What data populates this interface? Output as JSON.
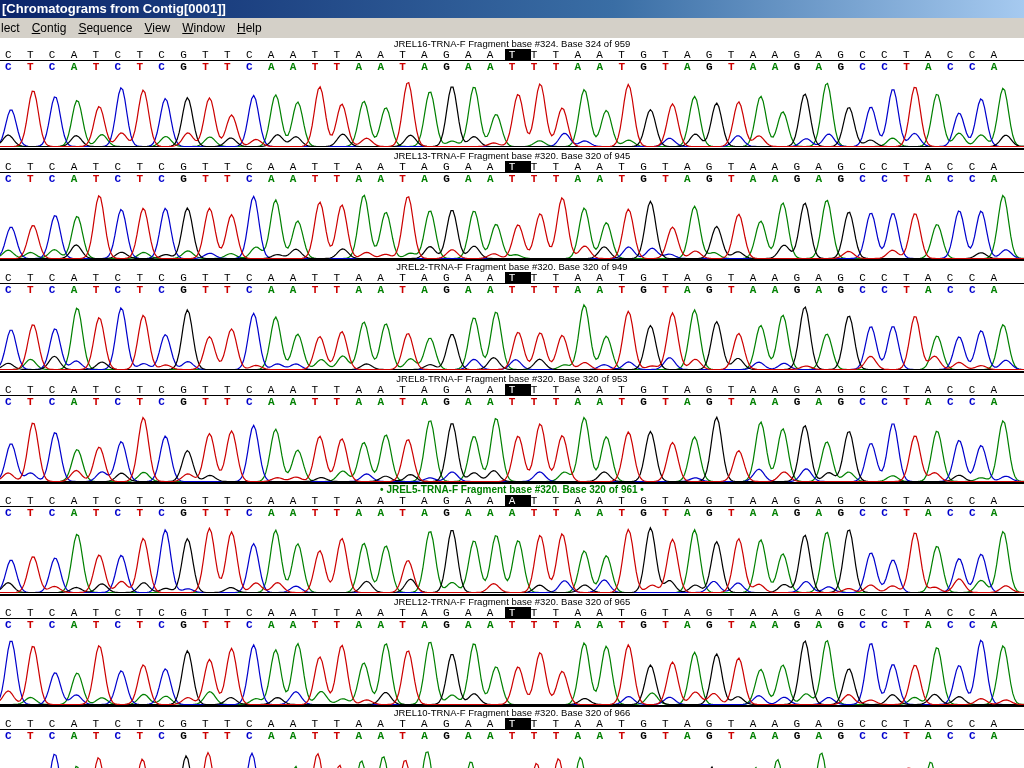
{
  "window": {
    "title": "[Chromatograms from Contig[0001]]"
  },
  "menu": [
    {
      "label": "lect",
      "underline_first": false
    },
    {
      "label": "Contig",
      "underline_first": true
    },
    {
      "label": "Sequence",
      "underline_first": true
    },
    {
      "label": "View",
      "underline_first": true
    },
    {
      "label": "Window",
      "underline_first": true
    },
    {
      "label": "Help",
      "underline_first": true
    }
  ],
  "base_colors": {
    "A": {
      "color": "#008000"
    },
    "C": {
      "color": "#0000cc"
    },
    "G": {
      "color": "#000000"
    },
    "T": {
      "color": "#cc0000"
    }
  },
  "panels": [
    {
      "header": "JREL16-TRNA-F  Fragment base #324. Base 324 of 959",
      "selected": false,
      "consensus": {
        "before": "CTCATCTCGTTCAATTAATAGAA",
        "cursor": "T",
        "after": "TTAATGTAGTAAGAGCCTACCA"
      },
      "called": "CTCATCTCGTTCAATTAATAGAATTTAATGTAGTAAGAGCCTACCA"
    },
    {
      "header": "JREL13-TRNA-F  Fragment base #320. Base 320 of 945",
      "selected": false,
      "consensus": {
        "before": "CTCATCTCGTTCAATTAATAGAA",
        "cursor": "T",
        "after": "TTAATGTAGTAAGAGCCTACCA"
      },
      "called": "CTCATCTCGTTCAATTAATAGAATTTAATGTAGTAAGAGCCTACCA"
    },
    {
      "header": "JREL2-TRNA-F  Fragment base #320. Base 320 of 949",
      "selected": false,
      "consensus": {
        "before": "CTCATCTCGTTCAATTAATAGAA",
        "cursor": "T",
        "after": "TTAATGTAGTAAGAGCCTACCA"
      },
      "called": "CTCATCTCGTTCAATTAATAGAATTTAATGTAGTAAGAGCCTACCA"
    },
    {
      "header": "JREL8-TRNA-F  Fragment base #320. Base 320 of 953",
      "selected": false,
      "consensus": {
        "before": "CTCATCTCGTTCAATTAATAGAA",
        "cursor": "T",
        "after": "TTAATGTAGTAAGAGCCTACCA"
      },
      "called": "CTCATCTCGTTCAATTAATAGAATTTAATGTAGTAAGAGCCTACCA"
    },
    {
      "header": "• JREL5-TRNA-F Fragment base #320. Base 320 of 961 •",
      "selected": true,
      "consensus": {
        "before": "CTCATCTCGTTCAATTAATAGAA",
        "cursor": "A",
        "after": "TTAATGTAGTAAGAGCCTACCA"
      },
      "called": "CTCATCTCGTTCAATTAATAGAAATTAATGTAGTAAGAGCCTACCA"
    },
    {
      "header": "JREL12-TRNA-F  Fragment base #320. Base 320 of 965",
      "selected": false,
      "consensus": {
        "before": "CTCATCTCGTTCAATTAATAGAA",
        "cursor": "T",
        "after": "TTAATGTAGTAAGAGCCTACCA"
      },
      "called": "CTCATCTCGTTCAATTAATAGAATTTAATGTAGTAAGAGCCTACCA"
    },
    {
      "header": "JREL10-TRNA-F  Fragment base #320. Base 320 of 966",
      "selected": false,
      "consensus": {
        "before": "CTCATCTCGTTCAATTAATAGAA",
        "cursor": "T",
        "after": "TTAATGTAGTAAGAGCCTACCA"
      },
      "called": "CTCATCTCGTTCAATTAATAGAATTTAATGTAGTAAGAGCCTACCA"
    }
  ]
}
